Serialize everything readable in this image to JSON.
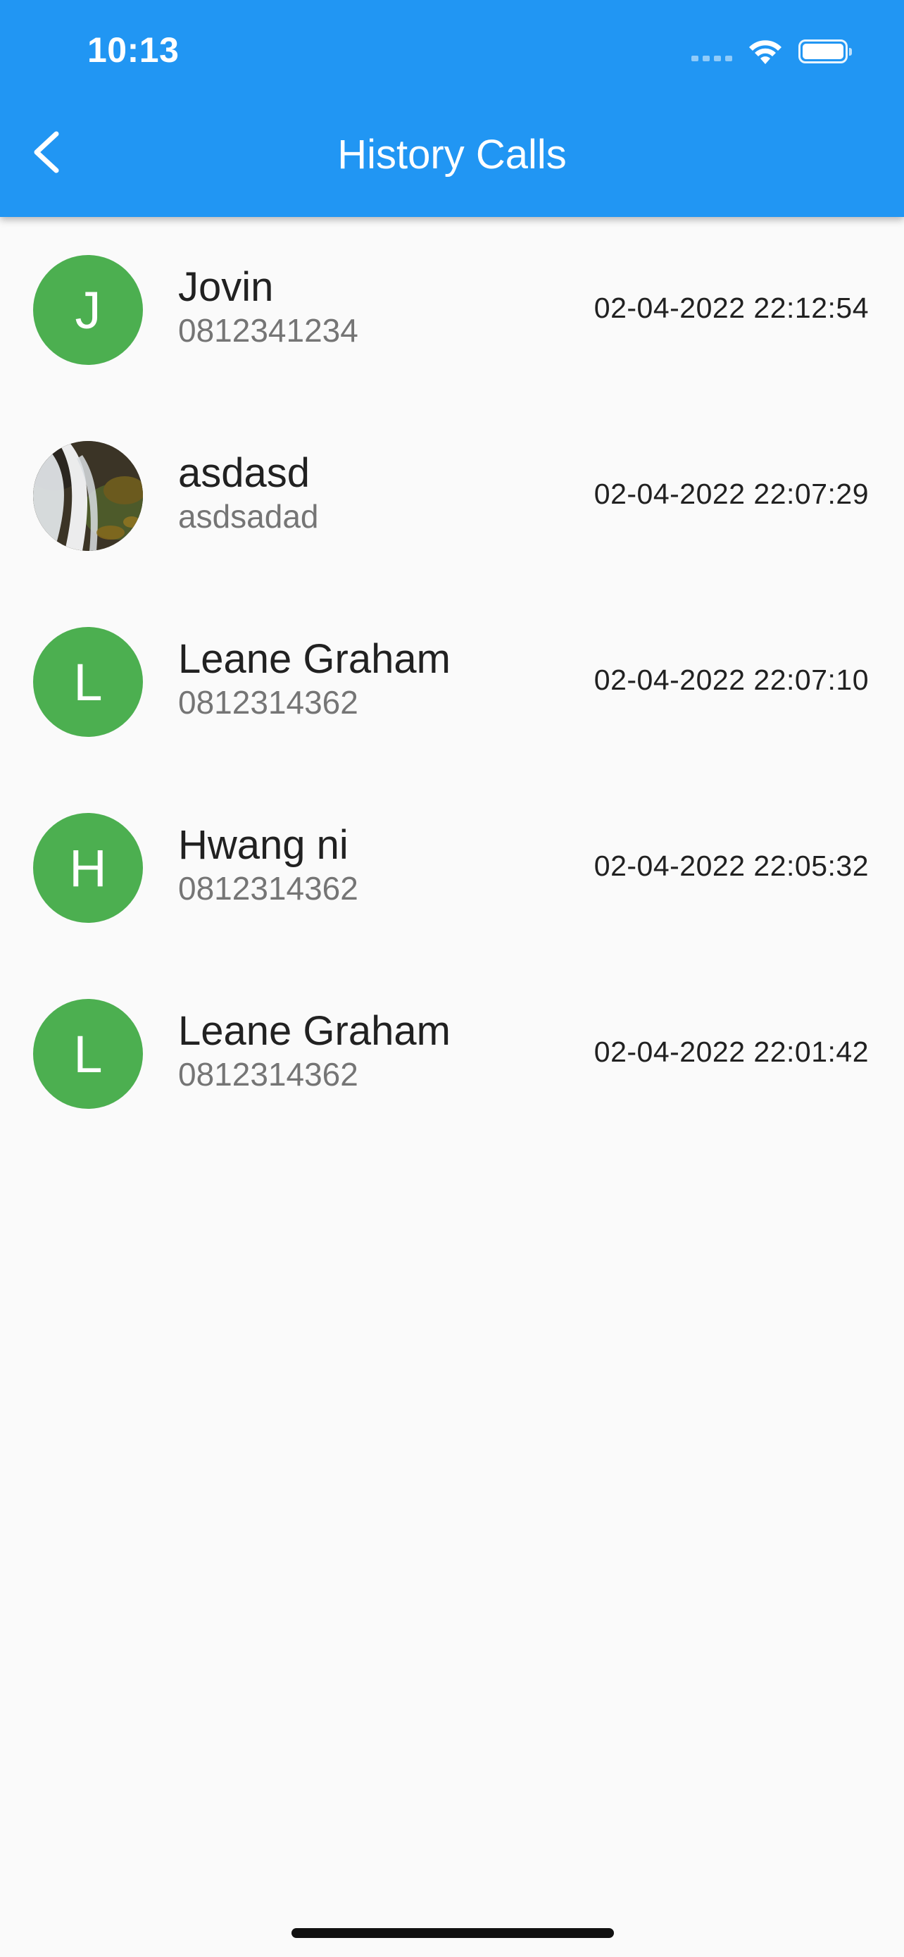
{
  "status_bar": {
    "time": "10:13"
  },
  "app_bar": {
    "title": "History Calls",
    "back_icon": "chevron-left-icon",
    "background_color": "#2196f3"
  },
  "calls": [
    {
      "initial": "J",
      "name": "Jovin",
      "number": "0812341234",
      "timestamp": "02-04-2022 22:12:54",
      "avatar_type": "initial"
    },
    {
      "initial": "",
      "name": "asdasd",
      "number": "asdsadad",
      "timestamp": "02-04-2022 22:07:29",
      "avatar_type": "photo"
    },
    {
      "initial": "L",
      "name": "Leane Graham",
      "number": "0812314362",
      "timestamp": "02-04-2022 22:07:10",
      "avatar_type": "initial"
    },
    {
      "initial": "H",
      "name": "Hwang ni",
      "number": "0812314362",
      "timestamp": "02-04-2022 22:05:32",
      "avatar_type": "initial"
    },
    {
      "initial": "L",
      "name": "Leane Graham",
      "number": "0812314362",
      "timestamp": "02-04-2022 22:01:42",
      "avatar_type": "initial"
    }
  ],
  "colors": {
    "avatar_green": "#4caf50",
    "background": "#fafafa"
  }
}
